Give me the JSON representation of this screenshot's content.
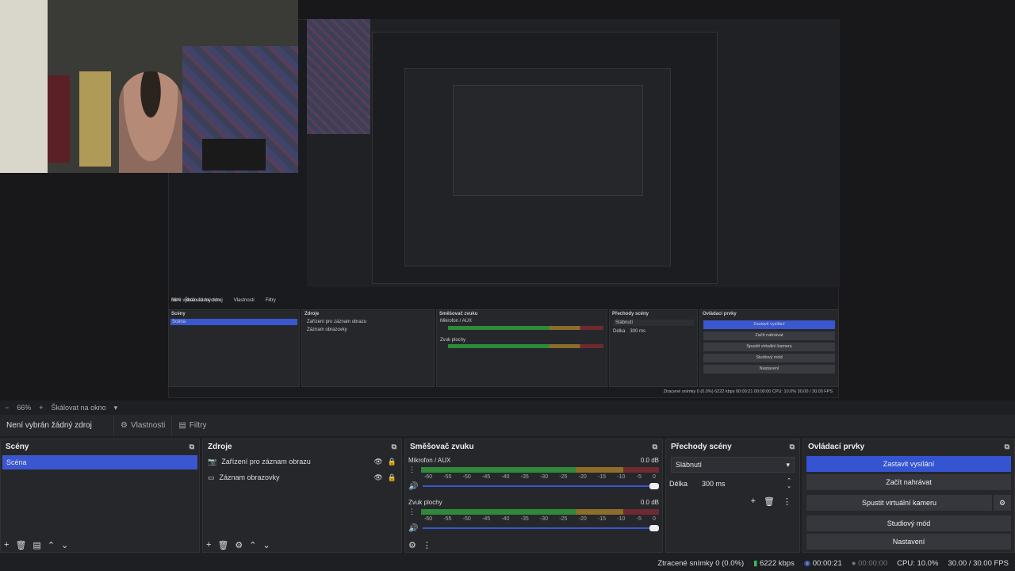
{
  "mini_ui": {
    "no_source": "Není vybrán žádný zdroj",
    "props": "Vlastnosti",
    "filters": "Filtry",
    "scenes_title": "Scény",
    "scene_item": "Scéna",
    "sources_title": "Zdroje",
    "source1": "Zařízení pro záznam obrazu",
    "source2": "Záznam obrazovky",
    "mixer_title": "Směšovač zvuku",
    "mic": "Mikrofon / AUX",
    "desktop": "Zvuk plochy",
    "trans_title": "Přechody scény",
    "trans_value": "Slábnutí",
    "duration_label": "Délka",
    "duration_value": "300 ms",
    "ctrl_title": "Ovládací prvky",
    "stop_stream": "Zastavit vysílání",
    "start_rec": "Začít nahrávat",
    "virtual_cam": "Spustit virtuální kameru",
    "studio": "Studiový mód",
    "settings": "Nastavení",
    "status": "Ztracené snímky 0 (0.0%)   6222 kbps   00:00:21   00:00:00   CPU: 10.0%   30.00 / 30.00 FPS",
    "zoom": "66%",
    "scale": "Škálovat na okno"
  },
  "zoom_bar": {
    "minus": "−",
    "percent": "66%",
    "plus": "+",
    "scale_label": "Škálovat na okno",
    "caret": "▾"
  },
  "source_toolbar": {
    "no_source": "Není vybrán žádný zdroj",
    "properties": "Vlastnosti",
    "filters": "Filtry"
  },
  "scenes": {
    "title": "Scény",
    "items": [
      "Scéna"
    ]
  },
  "sources": {
    "title": "Zdroje",
    "items": [
      "Zařízení pro záznam obrazu",
      "Záznam obrazovky"
    ]
  },
  "mixer": {
    "title": "Směšovač zvuku",
    "channels": [
      {
        "name": "Mikrofon / AUX",
        "db": "0.0 dB"
      },
      {
        "name": "Zvuk plochy",
        "db": "0.0 dB"
      }
    ],
    "ticks": [
      "-60",
      "-55",
      "-50",
      "-45",
      "-40",
      "-35",
      "-30",
      "-25",
      "-20",
      "-15",
      "-10",
      "-5",
      "0"
    ]
  },
  "transitions": {
    "title": "Přechody scény",
    "selected": "Slábnutí",
    "duration_label": "Délka",
    "duration_value": "300 ms"
  },
  "controls": {
    "title": "Ovládací prvky",
    "stop_streaming": "Zastavit vysílání",
    "start_recording": "Začít nahrávat",
    "start_virtual_camera": "Spustit virtuální kameru",
    "studio_mode": "Studiový mód",
    "settings": "Nastavení"
  },
  "status": {
    "dropped": "Ztracené snímky 0 (0.0%)",
    "bitrate": "6222 kbps",
    "stream_time": "00:00:21",
    "rec_time": "00:00:00",
    "cpu": "CPU: 10.0%",
    "fps": "30.00 / 30.00 FPS"
  },
  "colors": {
    "accent": "#3454d1",
    "meter_green": "#2e8a3a",
    "meter_yellow": "#8a6e2a",
    "meter_red": "#6e2a30"
  }
}
